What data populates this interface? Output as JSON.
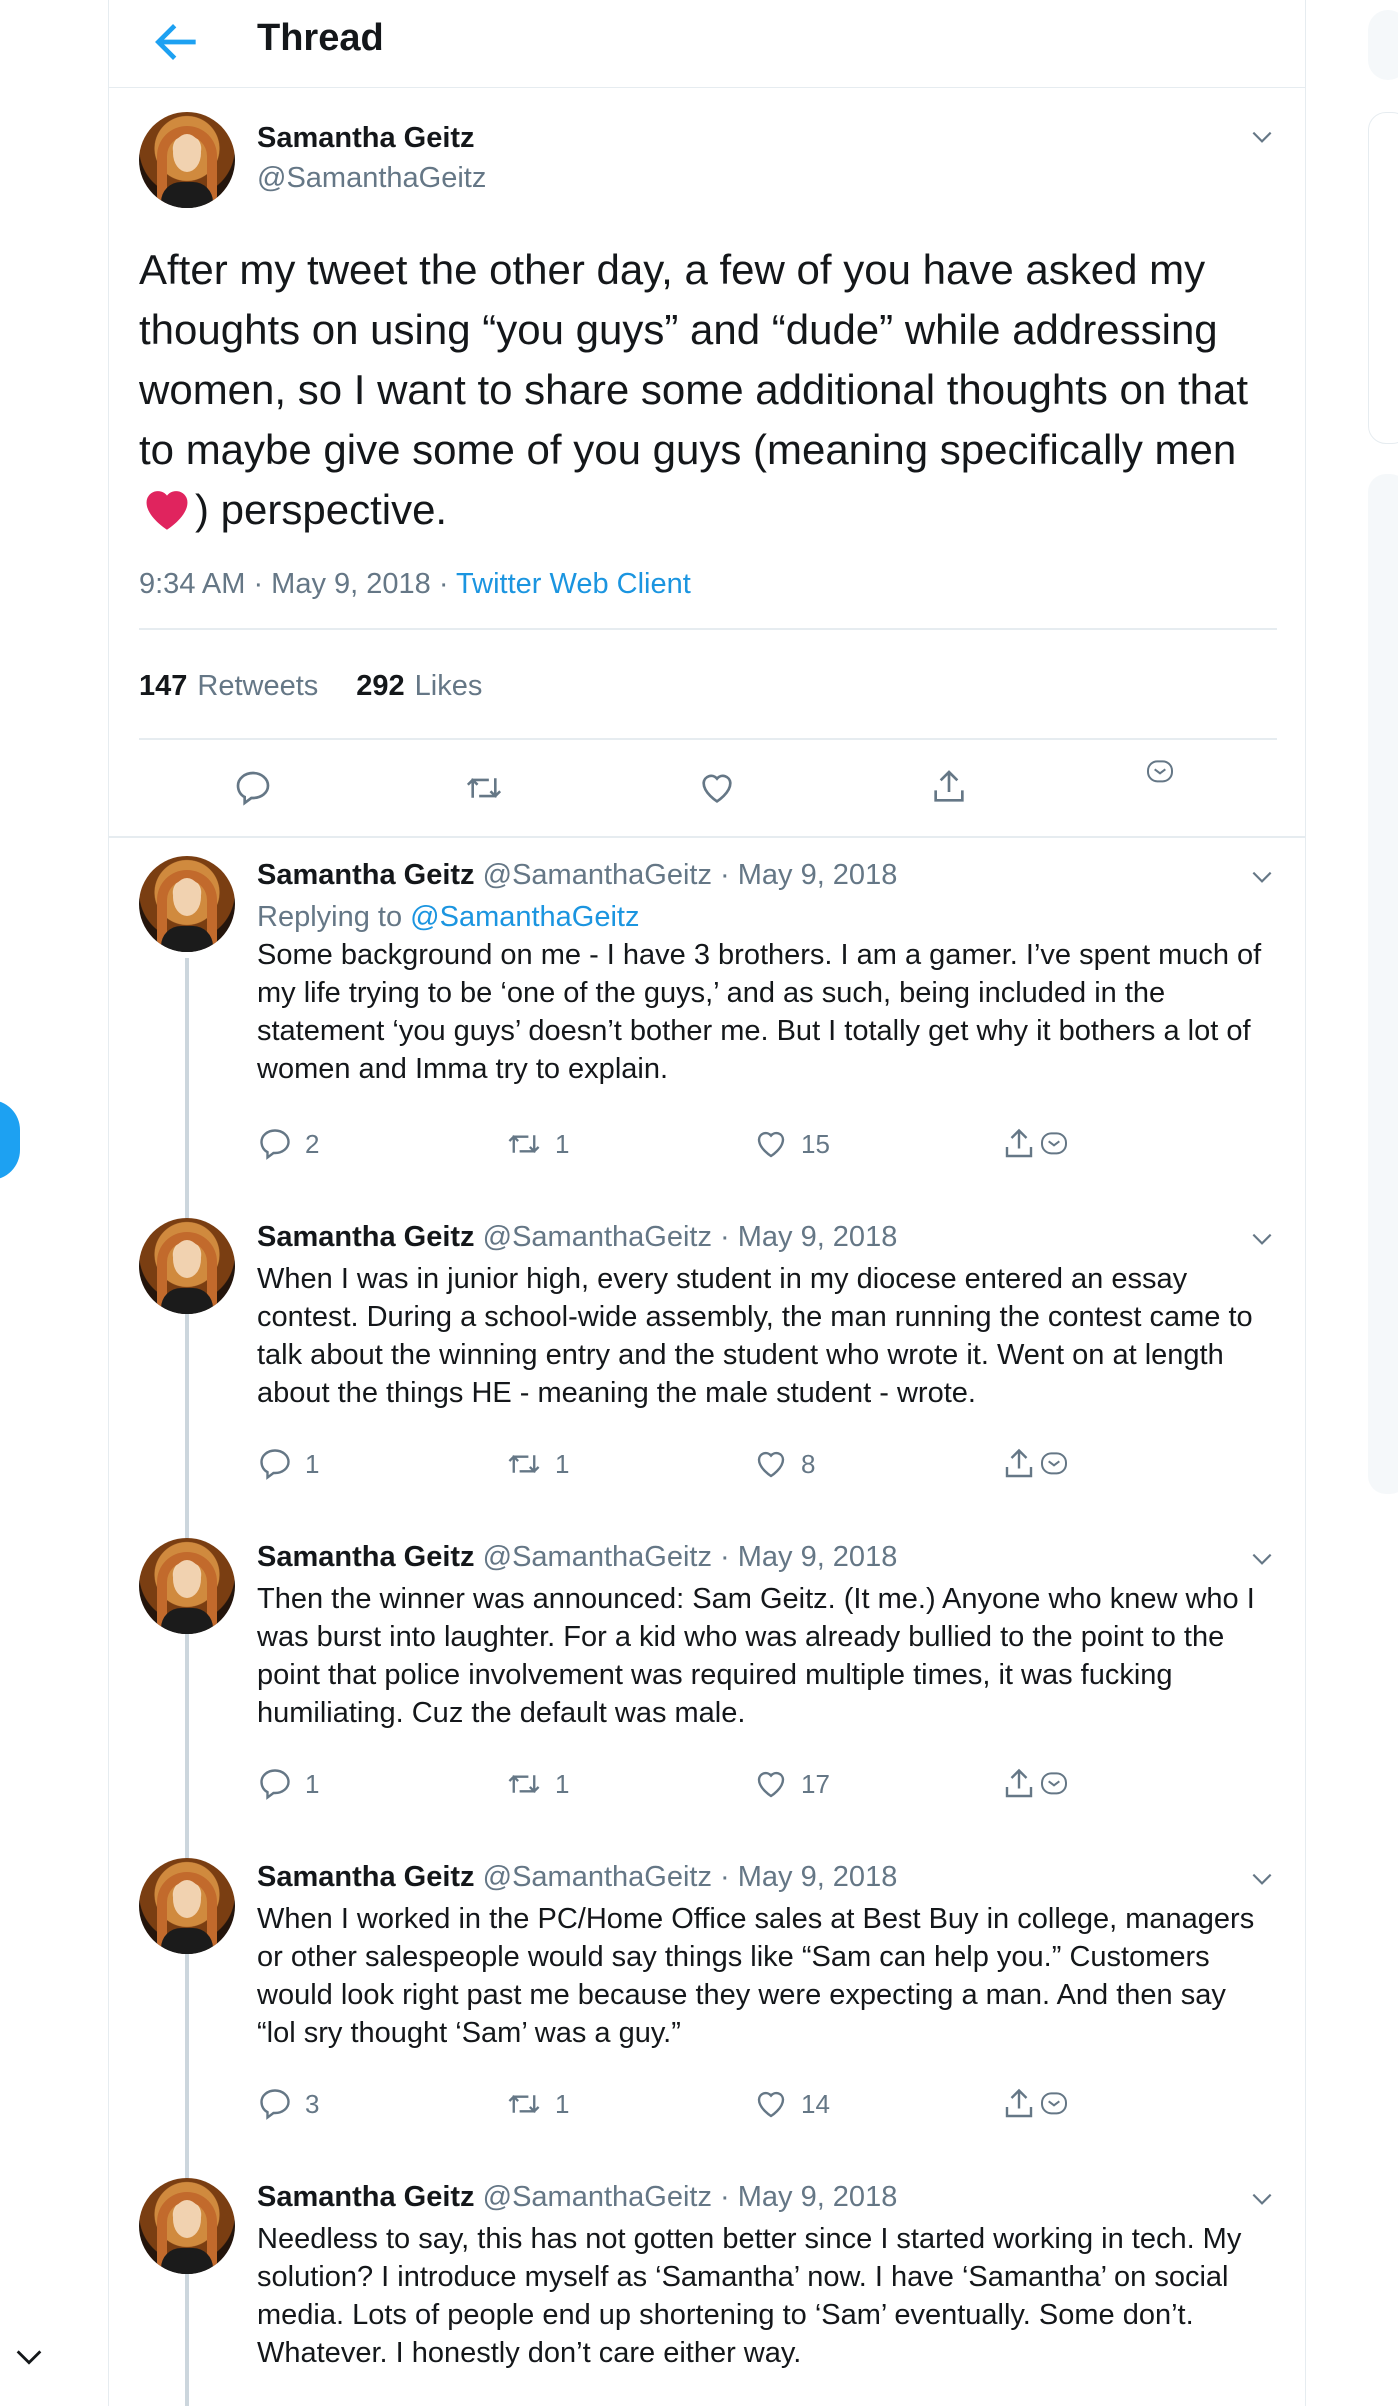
{
  "header": {
    "title": "Thread"
  },
  "main_tweet": {
    "name": "Samantha Geitz",
    "handle": "@SamanthaGeitz",
    "text_before_emoji": "After my tweet the other day, a few of you have asked my thoughts on using “you guys” and “dude” while addressing women, so I want to share some additional thoughts on that to maybe give some of you guys (meaning specifically men ",
    "emoji": "heart-emoji",
    "text_after_emoji": ") perspective.",
    "time": "9:34 AM · May 9, 2018 · ",
    "client": "Twitter Web Client",
    "retweets_count": "147",
    "retweets_label": "Retweets",
    "likes_count": "292",
    "likes_label": "Likes"
  },
  "replies": [
    {
      "name": "Samantha Geitz",
      "handle_date": "@SamanthaGeitz · May 9, 2018",
      "replying_prefix": "Replying to ",
      "replying_handle": "@SamanthaGeitz",
      "text": "Some background on me - I have 3 brothers. I am a gamer. I’ve spent much of my life trying to be ‘one of the guys,’ and as such, being included in the statement ‘you guys’ doesn’t bother me. But I totally get why it bothers a lot of women and Imma try to explain.",
      "replies": "2",
      "retweets": "1",
      "likes": "15"
    },
    {
      "name": "Samantha Geitz",
      "handle_date": "@SamanthaGeitz · May 9, 2018",
      "text": "When I was in junior high, every student in my diocese entered an essay contest. During a school-wide assembly, the man running the contest came to talk about the winning entry and the student who wrote it. Went on at length about the things HE - meaning the male student - wrote.",
      "replies": "1",
      "retweets": "1",
      "likes": "8"
    },
    {
      "name": "Samantha Geitz",
      "handle_date": "@SamanthaGeitz · May 9, 2018",
      "text": "Then the winner was announced: Sam Geitz. (It me.) Anyone who knew who I was burst into laughter. For a kid who was already bullied to the point to the point that police involvement was required multiple times, it was fucking humiliating. Cuz the default was male.",
      "replies": "1",
      "retweets": "1",
      "likes": "17"
    },
    {
      "name": "Samantha Geitz",
      "handle_date": "@SamanthaGeitz · May 9, 2018",
      "text": "When I worked in the PC/Home Office sales at Best Buy in college, managers or other salespeople would say things like “Sam can help you.” Customers would look right past me because they were expecting a man. And then say “lol sry thought ‘Sam’ was a guy.”",
      "replies": "3",
      "retweets": "1",
      "likes": "14"
    },
    {
      "name": "Samantha Geitz",
      "handle_date": "@SamanthaGeitz · May 9, 2018",
      "text": "Needless to say, this has not gotten better since I started working in tech. My solution? I introduce myself as ‘Samantha’ now. I have ‘Samantha’ on social media. Lots of people end up shortening to ‘Sam’ eventually. Some don’t. Whatever. I honestly don’t care either way."
    }
  ],
  "colors": {
    "accent": "#1da1f2",
    "heart": "#e0245e",
    "muted": "#657786"
  }
}
